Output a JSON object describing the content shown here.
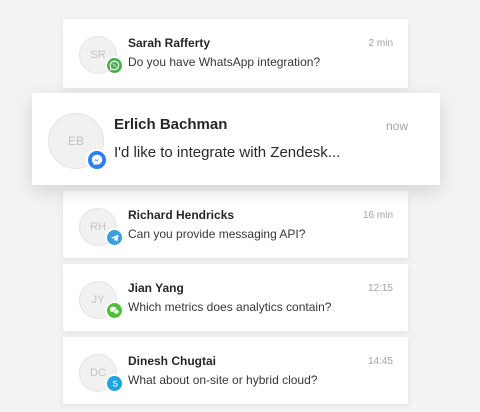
{
  "conversations": [
    {
      "initials": "SR",
      "name": "Sarah Rafferty",
      "message": "Do you have WhatsApp integration?",
      "time": "2 min",
      "channel": "whatsapp",
      "channel_color": "#4caf50"
    },
    {
      "initials": "EB",
      "name": "Erlich Bachman",
      "message": "I'd like to integrate with Zendesk...",
      "time": "now",
      "channel": "messenger",
      "channel_color": "#2d7ff9",
      "highlighted": true
    },
    {
      "initials": "RH",
      "name": "Richard Hendricks",
      "message": "Can you provide messaging API?",
      "time": "16 min",
      "channel": "telegram",
      "channel_color": "#3a9fdc"
    },
    {
      "initials": "JY",
      "name": "Jian Yang",
      "message": "Which metrics does analytics contain?",
      "time": "12:15",
      "channel": "wechat",
      "channel_color": "#52bf3a"
    },
    {
      "initials": "DC",
      "name": "Dinesh Chugtai",
      "message": "What about on-site or hybrid cloud?",
      "time": "14:45",
      "channel": "skype",
      "channel_color": "#1ea2e0"
    }
  ]
}
